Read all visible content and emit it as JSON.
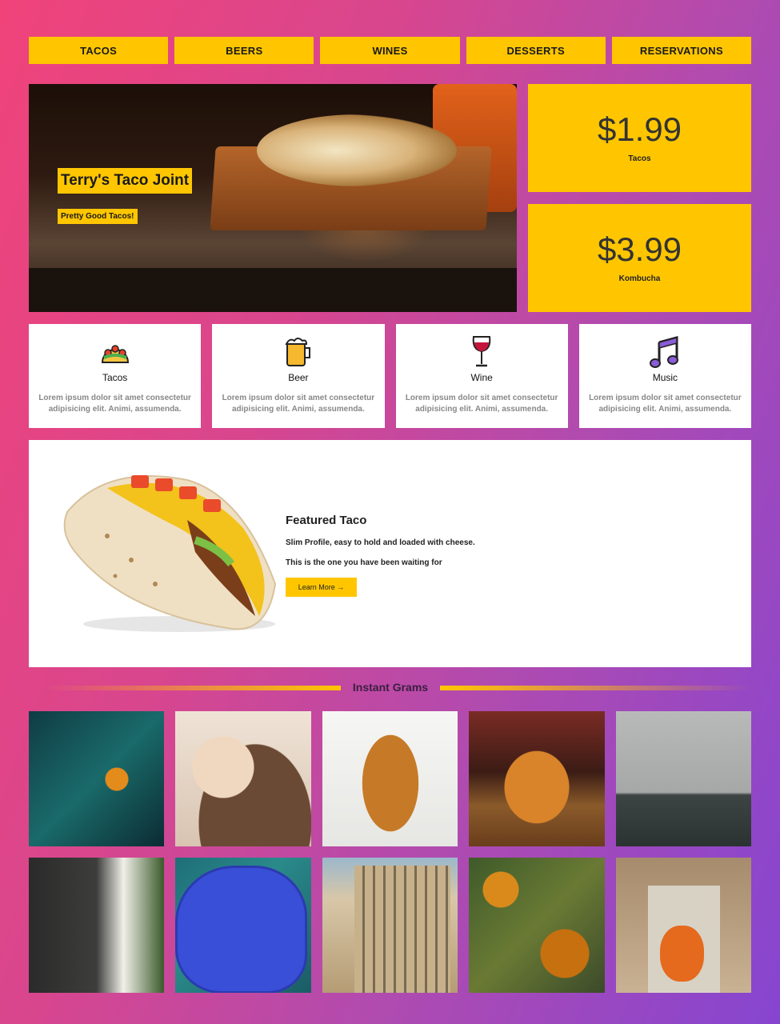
{
  "nav": {
    "items": [
      "TACOS",
      "BEERS",
      "WINES",
      "DESSERTS",
      "RESERVATIONS"
    ]
  },
  "hero": {
    "title": "Terry's Taco Joint",
    "subtitle": "Pretty Good Tacos!"
  },
  "prices": [
    {
      "amount": "$1.99",
      "label": "Tacos"
    },
    {
      "amount": "$3.99",
      "label": "Kombucha"
    }
  ],
  "features": [
    {
      "icon": "taco-icon",
      "name": "Tacos",
      "desc": "Lorem ipsum dolor sit amet consectetur adipisicing elit. Animi, assumenda."
    },
    {
      "icon": "beer-icon",
      "name": "Beer",
      "desc": "Lorem ipsum dolor sit amet consectetur adipisicing elit. Animi, assumenda."
    },
    {
      "icon": "wine-icon",
      "name": "Wine",
      "desc": "Lorem ipsum dolor sit amet consectetur adipisicing elit. Animi, assumenda."
    },
    {
      "icon": "music-icon",
      "name": "Music",
      "desc": "Lorem ipsum dolor sit amet consectetur adipisicing elit. Animi, assumenda."
    }
  ],
  "featured": {
    "title": "Featured Taco",
    "line1": "Slim Profile, easy to hold and loaded with cheese.",
    "line2": "This is the one you have been waiting for",
    "button": "Learn More →"
  },
  "grams": {
    "title": "Instant Grams"
  },
  "colors": {
    "accent": "#ffc600",
    "gradient_start": "#f0437a",
    "gradient_end": "#8645d0"
  }
}
